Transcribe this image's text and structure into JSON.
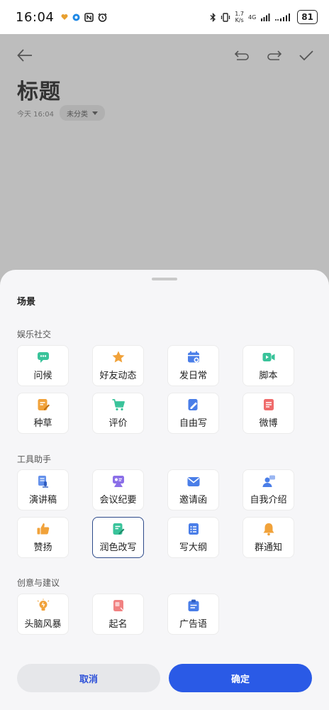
{
  "status": {
    "time": "16:04",
    "net_speed_value": "1.7",
    "net_speed_unit": "K/s",
    "network": "4G",
    "battery": "81"
  },
  "editor": {
    "title": "标题",
    "date": "今天 16:04",
    "category": "未分类"
  },
  "sheet": {
    "title": "场景",
    "sections": [
      {
        "label": "娱乐社交",
        "items": [
          {
            "label": "问候",
            "icon": "chat-icon",
            "color": "#39c39a"
          },
          {
            "label": "好友动态",
            "icon": "star-icon",
            "color": "#f1a23a"
          },
          {
            "label": "发日常",
            "icon": "calendar-add-icon",
            "color": "#4a7ee8"
          },
          {
            "label": "脚本",
            "icon": "video-icon",
            "color": "#39c39a"
          },
          {
            "label": "种草",
            "icon": "note-edit-icon",
            "color": "#f1a23a"
          },
          {
            "label": "评价",
            "icon": "cart-icon",
            "color": "#39c39a"
          },
          {
            "label": "自由写",
            "icon": "pen-icon",
            "color": "#4a7ee8"
          },
          {
            "label": "微博",
            "icon": "document-icon",
            "color": "#ef6b6b"
          }
        ]
      },
      {
        "label": "工具助手",
        "items": [
          {
            "label": "演讲稿",
            "icon": "speech-icon",
            "color": "#4a7ee8"
          },
          {
            "label": "会议纪要",
            "icon": "meeting-icon",
            "color": "#8b6fe8"
          },
          {
            "label": "邀请函",
            "icon": "envelope-icon",
            "color": "#4a7ee8"
          },
          {
            "label": "自我介绍",
            "icon": "user-icon",
            "color": "#4a7ee8"
          },
          {
            "label": "赞扬",
            "icon": "thumbs-up-icon",
            "color": "#f1a23a"
          },
          {
            "label": "润色改写",
            "icon": "note-pen-icon",
            "color": "#39c39a",
            "selected": true
          },
          {
            "label": "写大纲",
            "icon": "list-icon",
            "color": "#4a7ee8"
          },
          {
            "label": "群通知",
            "icon": "bell-icon",
            "color": "#f1a23a"
          }
        ]
      },
      {
        "label": "创意与建议",
        "items": [
          {
            "label": "头脑风暴",
            "icon": "bulb-icon",
            "color": "#f1a23a"
          },
          {
            "label": "起名",
            "icon": "name-tag-icon",
            "color": "#ef6b6b"
          },
          {
            "label": "广告语",
            "icon": "clipboard-icon",
            "color": "#4a7ee8"
          }
        ]
      }
    ],
    "cancel_label": "取消",
    "ok_label": "确定"
  }
}
